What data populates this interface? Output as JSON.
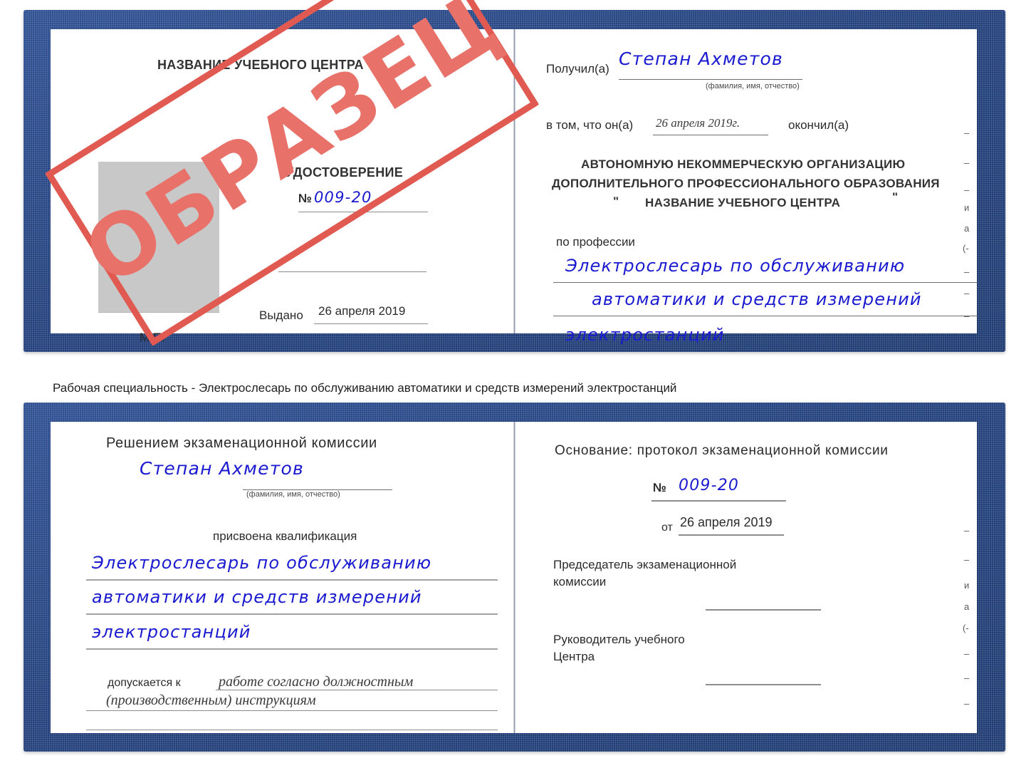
{
  "caption": {
    "text": "Рабочая специальность - Электрослесарь по обслуживанию автоматики и средств измерений электростанций"
  },
  "stamp": {
    "label": "ОБРАЗЕЦ",
    "color": "#e8726a",
    "border_color": "#e05a52"
  },
  "certificate_1": {
    "left_page": {
      "org_title": "НАЗВАНИЕ УЧЕБНОГО ЦЕНТРА",
      "doc_type": "УДОСТОВЕРЕНИЕ",
      "number_label": "№",
      "number_value": "009-20",
      "issued_label": "Выдано",
      "issued_value": "26 апреля 2019",
      "seal_label": "М.П."
    },
    "right_page": {
      "received_label": "Получил(а)",
      "received_value": "Степан Ахметов",
      "name_hint": "(фамилия, имя, отчество)",
      "in_that_label": "в том, что он(а)",
      "in_that_value": "26 апреля 2019г.",
      "finished_label": "окончил(а)",
      "org_line_1": "АВТОНОМНУЮ НЕКОММЕРЧЕСКУЮ ОРГАНИЗАЦИЮ",
      "org_line_2": "ДОПОЛНИТЕЛЬНОГО ПРОФЕССИОНАЛЬНОГО ОБРАЗОВАНИЯ",
      "org_quote_open": "\"",
      "org_line_3": "НАЗВАНИЕ УЧЕБНОГО ЦЕНТРА",
      "org_quote_close": "\"",
      "profession_label": "по профессии",
      "profession_line_1": "Электрослесарь по обслуживанию",
      "profession_line_2": "автоматики и средств измерений",
      "profession_line_3": "электростанций"
    },
    "edge_marks": [
      "–",
      "–",
      "–",
      "и",
      "а",
      "(-",
      "–",
      "–",
      "–"
    ]
  },
  "certificate_2": {
    "left_page": {
      "decision_title": "Решением экзаменационной комиссии",
      "name_value": "Степан Ахметов",
      "name_hint": "(фамилия, имя, отчество)",
      "qualification_label": "присвоена квалификация",
      "qualification_line_1": "Электрослесарь по обслуживанию",
      "qualification_line_2": "автоматики и средств измерений",
      "qualification_line_3": "электростанций",
      "allowed_label": "допускается к",
      "allowed_value_1": "работе согласно должностным",
      "allowed_value_2": "(производственным) инструкциям"
    },
    "right_page": {
      "basis_label": "Основание: протокол экзаменационной комиссии",
      "number_label": "№",
      "number_value": "009-20",
      "date_label": "от",
      "date_value": "26 апреля 2019",
      "chairman_line_1": "Председатель экзаменационной",
      "chairman_line_2": "комиссии",
      "head_line_1": "Руководитель учебного",
      "head_line_2": "Центра"
    },
    "edge_marks": [
      "–",
      "–",
      "и",
      "а",
      "(-",
      "–",
      "–",
      "–"
    ]
  }
}
